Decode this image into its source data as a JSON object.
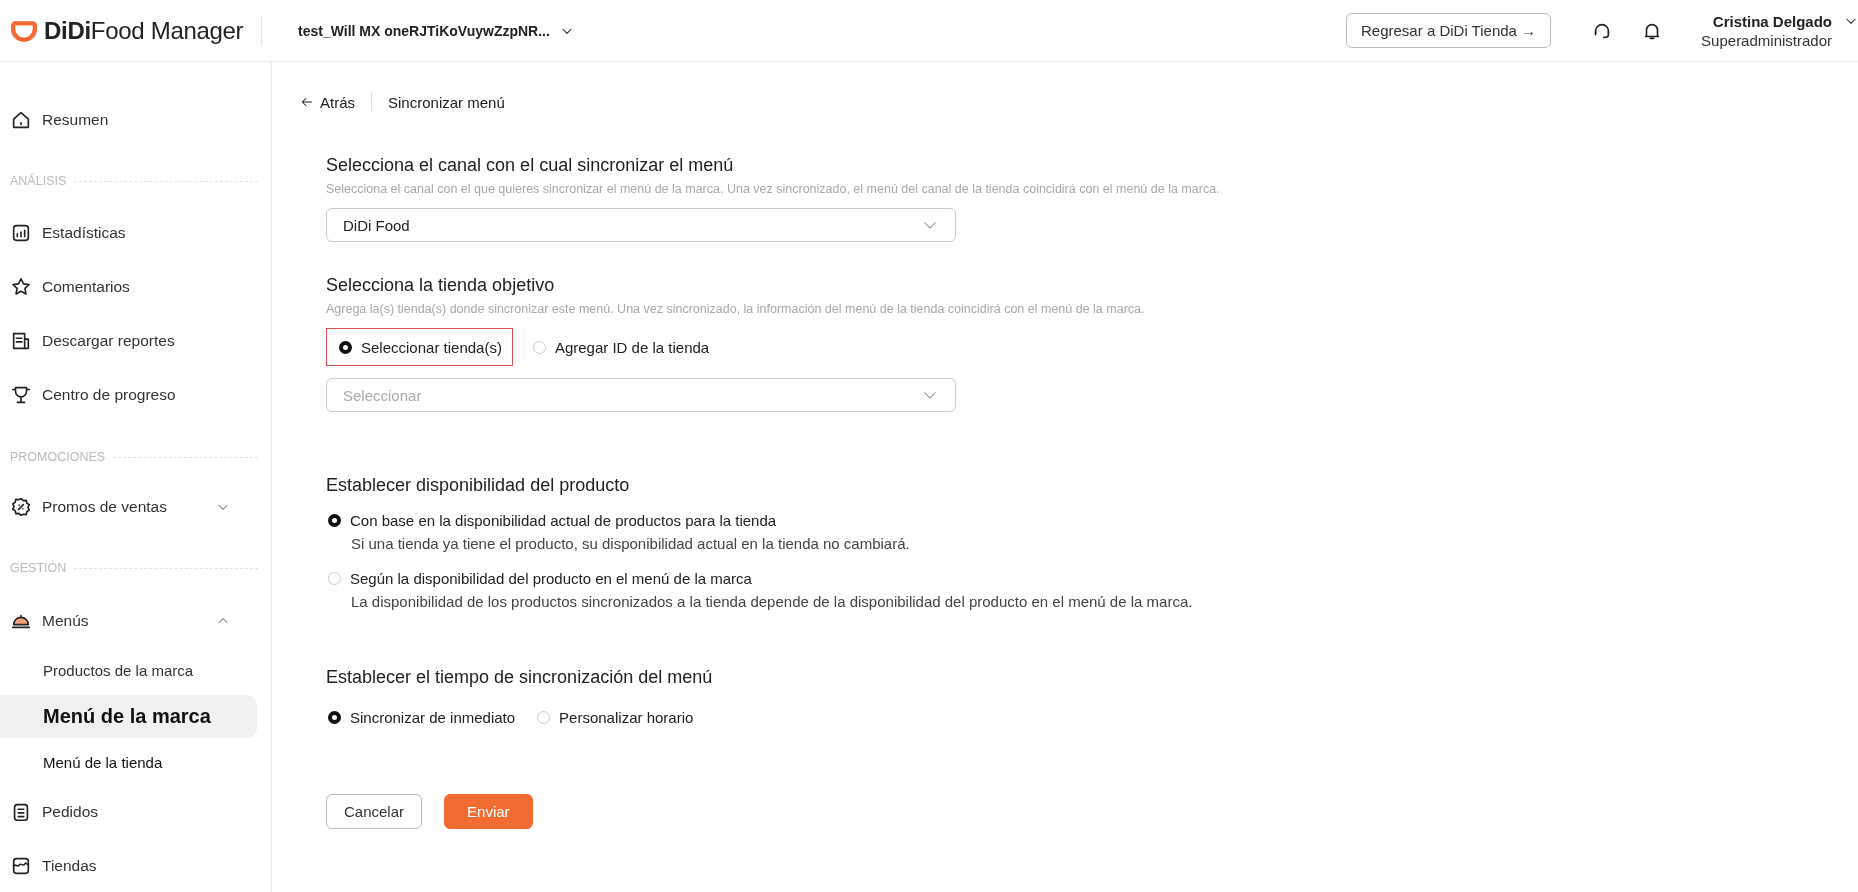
{
  "header": {
    "logo": {
      "brand": "DiDi",
      "product": "Food Manager"
    },
    "store_selector": {
      "label": "test_Will MX oneRJTiKoVuywZzpNR..."
    },
    "return_button": {
      "label": "Regresar a DiDi Tienda →"
    },
    "user": {
      "name": "Cristina Delgado",
      "role": "Superadministrador"
    }
  },
  "sidebar": {
    "items": [
      {
        "kind": "item",
        "label": "Resumen"
      },
      {
        "kind": "section",
        "label": "ANÁLISIS"
      },
      {
        "kind": "item",
        "label": "Estadísticas"
      },
      {
        "kind": "item",
        "label": "Comentarios"
      },
      {
        "kind": "item",
        "label": "Descargar reportes"
      },
      {
        "kind": "item",
        "label": "Centro de progreso"
      },
      {
        "kind": "section",
        "label": "PROMOCIONES"
      },
      {
        "kind": "item",
        "label": "Promos de ventas",
        "expanded": false
      },
      {
        "kind": "section",
        "label": "GESTIÓN"
      },
      {
        "kind": "item",
        "label": "Menús",
        "expanded": true
      },
      {
        "kind": "subitem",
        "label": "Productos de la marca",
        "selected": false
      },
      {
        "kind": "subitem",
        "label": "Menú de la marca",
        "selected": true
      },
      {
        "kind": "subitem",
        "label": "Menú de la tienda",
        "selected": false
      },
      {
        "kind": "item",
        "label": "Pedidos"
      },
      {
        "kind": "item",
        "label": "Tiendas"
      }
    ]
  },
  "breadcrumb": {
    "back": "Atrás",
    "current": "Sincronizar menú"
  },
  "sections": [
    {
      "title": "Selecciona el canal con el cual sincronizar el menú",
      "description": "Selecciona el canal con el que quieres sincronizar el menú de la marca. Una vez sincronizado, el menú del canal de la tienda coincidirá con el menú de la marca.",
      "fields": [
        {
          "kind": "select",
          "value": "DiDi Food"
        }
      ]
    },
    {
      "title": "Selecciona la tienda objetivo",
      "description": "Agrega la(s) tienda(s) donde sincronizar este menú. Una vez sincronizado, la información del menú de la tienda coincidirá con el menú de la marca.",
      "fields": [
        {
          "kind": "radio_row",
          "options": [
            {
              "label": "Seleccionar tienda(s)",
              "selected": true,
              "highlighted": true
            },
            {
              "label": "Agregar ID de la tienda",
              "selected": false,
              "highlighted": false
            }
          ]
        },
        {
          "kind": "select",
          "placeholder": "Seleccionar"
        }
      ]
    },
    {
      "title": "Establecer disponibilidad del producto",
      "fields": [
        {
          "kind": "radio_column",
          "options": [
            {
              "label": "Con base en la disponibilidad actual de productos para la tienda",
              "description": "Si una tienda ya tiene el producto, su disponibilidad actual en la tienda no cambiará.",
              "selected": true
            },
            {
              "label": "Según la disponibilidad del producto en el menú de la marca",
              "description": "La disponibilidad de los productos sincronizados a la tienda depende de la disponibilidad del producto en el menú de la marca.",
              "selected": false
            }
          ]
        }
      ]
    },
    {
      "title": "Establecer el tiempo de sincronización del menú",
      "fields": [
        {
          "kind": "radio_row",
          "options": [
            {
              "label": "Sincronizar de inmediato",
              "selected": true
            },
            {
              "label": "Personalizar horario",
              "selected": false
            }
          ]
        }
      ]
    }
  ],
  "buttons": [
    {
      "kind": "secondary",
      "label": "Cancelar"
    },
    {
      "kind": "primary",
      "label": "Enviar"
    }
  ]
}
